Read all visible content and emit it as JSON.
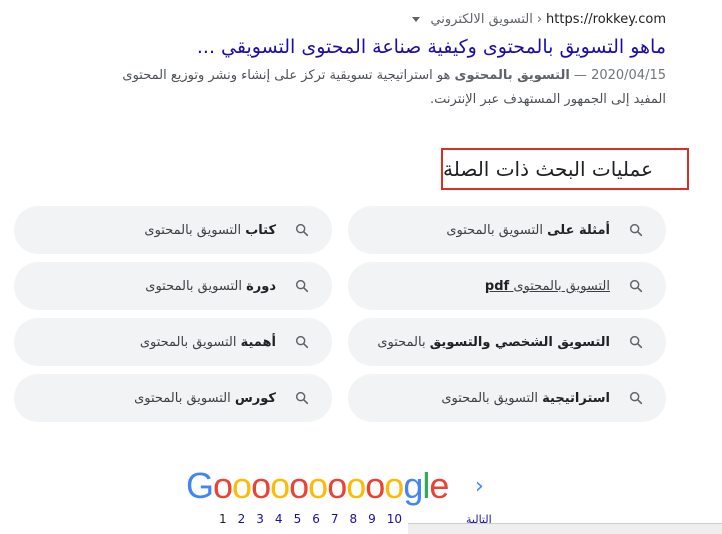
{
  "result": {
    "url": "https://rokkey.com",
    "separator": "›",
    "path": "التسويق الالكتروني",
    "title": "ماهو التسويق بالمحتوى وكيفية صناعة المحتوى التسويقي ...",
    "snippet_date": "2020/04/15",
    "snippet_dash": " — ",
    "snippet_bold": "التسويق بالمحتوى",
    "snippet_text": " هو استراتيجية تسويقية تركز على إنشاء ونشر وتوزيع المحتوى المفيد إلى الجمهور المستهدف عبر الإنترنت."
  },
  "related": {
    "header": "عمليات البحث ذات الصلة",
    "chips": [
      {
        "bold": "أمثلة على",
        "text": " التسويق بالمحتوى"
      },
      {
        "bold": "كتاب",
        "text": " التسويق بالمحتوى"
      },
      {
        "bold": "pdf",
        "text": "التسويق بالمحتوى "
      },
      {
        "bold": "دورة",
        "text": " التسويق بالمحتوى"
      },
      {
        "bold": "التسويق الشخصي والتسويق",
        "text": " بالمحتوى"
      },
      {
        "bold": "أهمية",
        "text": " التسويق بالمحتوى"
      },
      {
        "bold": "استراتيجية",
        "text": " التسويق بالمحتوى"
      },
      {
        "bold": "كورس",
        "text": " التسويق بالمحتوى"
      }
    ]
  },
  "pagination": {
    "logo_G": "G",
    "logo_o_count": 10,
    "logo_tail_g": "g",
    "logo_tail_l": "l",
    "logo_tail_e": "e",
    "next_chevron": "›",
    "pages": [
      "1",
      "2",
      "3",
      "4",
      "5",
      "6",
      "7",
      "8",
      "9",
      "10"
    ],
    "current_page": "1",
    "next_label": "التالية"
  },
  "colors": {
    "link": "#1a0dab",
    "highlight_border": "#d93025",
    "chip_bg": "#f1f3f4"
  }
}
